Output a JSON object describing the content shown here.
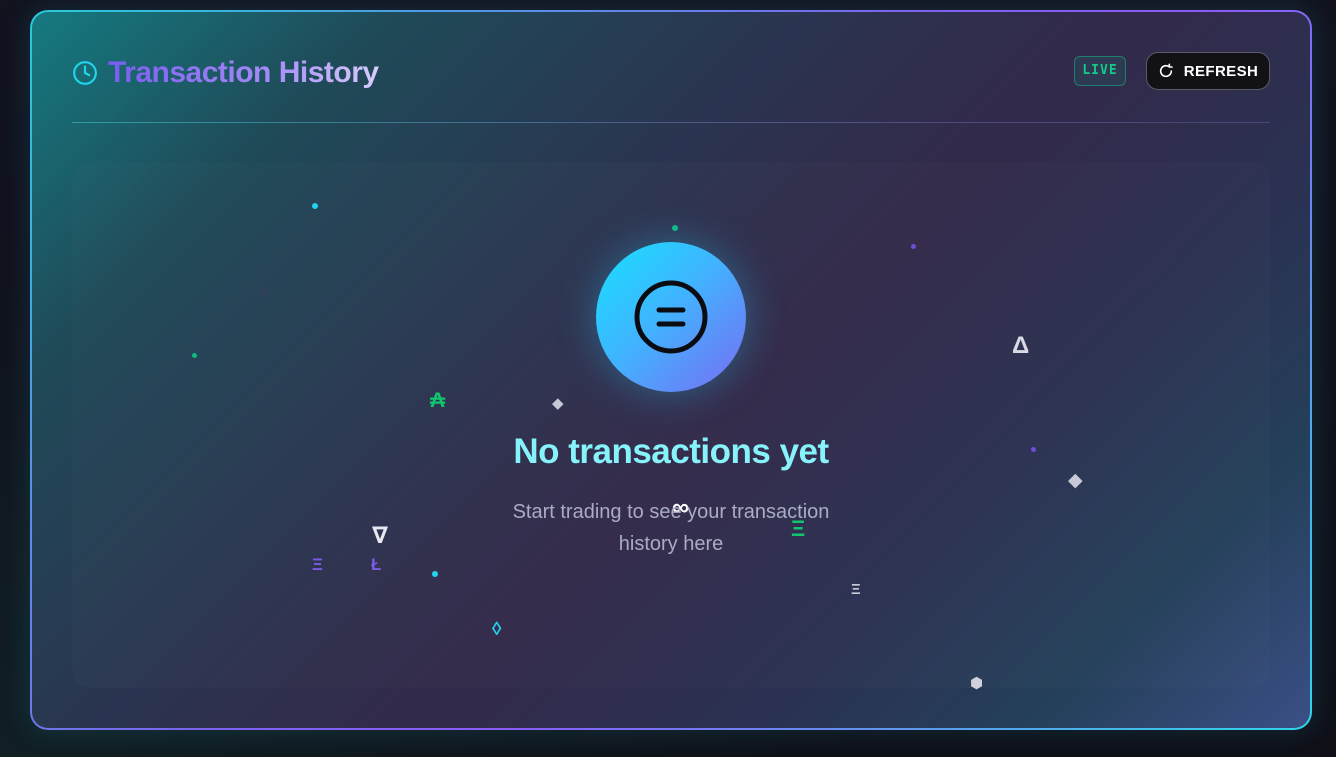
{
  "header": {
    "title": "Transaction History",
    "live_label": "LIVE",
    "refresh_label": "REFRESH"
  },
  "empty_state": {
    "title": "No transactions yet",
    "subtitle": "Start trading to see your transaction history here"
  },
  "icons": {
    "header": "clock-icon",
    "refresh": "refresh-icon",
    "empty": "coin-equals-icon"
  },
  "floating_symbols": [
    "₳",
    "◆",
    "Δ",
    "◆",
    "∞",
    "Ξ",
    "∇",
    "Ξ",
    "Ł",
    "Ξ",
    "◊",
    "⬢"
  ],
  "colors": {
    "accent_cyan": "#22d3ee",
    "accent_purple": "#8b5cf6",
    "live_green": "#14c98a",
    "empty_title": "#86f3fb",
    "subtitle": "#a9acc2",
    "refresh_bg": "#121216"
  }
}
